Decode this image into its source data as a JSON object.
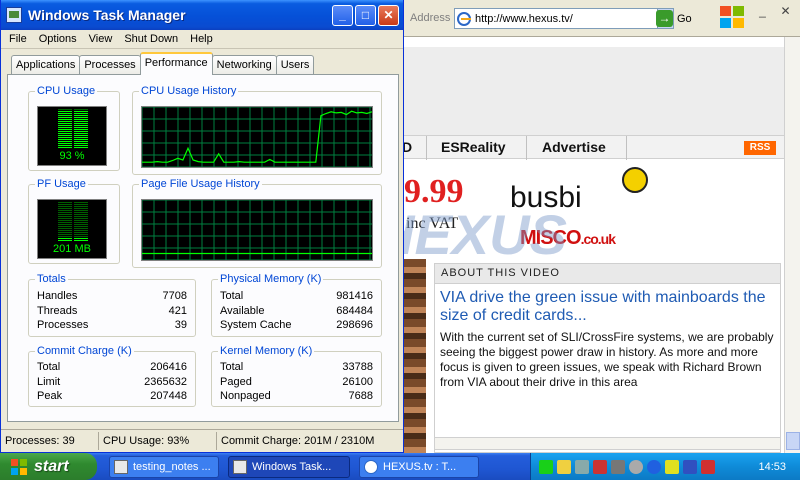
{
  "browser": {
    "address_label": "Address",
    "url": "http://www.hexus.tv/",
    "go_label": "Go",
    "nav": [
      "D",
      "ESReality",
      "Advertise"
    ],
    "rss": "RSS",
    "ad": {
      "price": "9.99",
      "vat": "inc VAT",
      "brand1": "busbi",
      "brand2": "MISCO",
      "brand2_suffix": ".co.uk"
    },
    "watermark": "HEXUS",
    "about": {
      "header": "ABOUT THIS VIDEO",
      "title": "VIA drive the green issue with mainboards the size of credit cards...",
      "body": "With the current set of SLI/CrossFire systems, we are probably seeing the biggest power draw in history. As more and more focus is given to green issues, we speak with Richard Brown from VIA about their drive in this area"
    }
  },
  "task_manager": {
    "title": "Windows Task Manager",
    "menu": [
      "File",
      "Options",
      "View",
      "Shut Down",
      "Help"
    ],
    "tabs": [
      "Applications",
      "Processes",
      "Performance",
      "Networking",
      "Users"
    ],
    "active_tab": "Performance",
    "cpu_usage": {
      "label": "CPU Usage",
      "value": "93 %",
      "percent": 93
    },
    "cpu_history": {
      "label": "CPU Usage History",
      "samples": [
        5,
        5,
        5,
        6,
        5,
        5,
        8,
        12,
        9,
        30,
        9,
        6,
        5,
        5,
        5,
        20,
        5,
        5,
        5,
        6,
        5,
        5,
        5,
        5,
        5,
        10,
        5,
        5,
        5,
        5,
        5,
        5,
        5,
        5,
        5,
        88,
        92,
        95,
        93,
        94,
        90,
        96,
        93,
        94,
        92,
        95
      ]
    },
    "pf_usage": {
      "label": "PF Usage",
      "value": "201 MB",
      "percent": 8
    },
    "pf_history": {
      "label": "Page File Usage History",
      "samples": [
        8,
        8,
        8,
        8,
        8,
        8,
        8,
        8,
        8,
        8,
        8,
        8,
        8,
        8,
        8,
        8,
        8,
        8,
        8,
        8,
        8,
        8,
        8,
        8,
        8,
        8,
        8,
        8,
        8,
        8,
        8,
        8,
        8,
        8,
        8,
        8,
        8,
        8,
        8,
        8,
        8,
        8,
        8,
        8,
        8,
        8
      ]
    },
    "totals": {
      "label": "Totals",
      "rows": [
        [
          "Handles",
          "7708"
        ],
        [
          "Threads",
          "421"
        ],
        [
          "Processes",
          "39"
        ]
      ]
    },
    "physical": {
      "label": "Physical Memory (K)",
      "rows": [
        [
          "Total",
          "981416"
        ],
        [
          "Available",
          "684484"
        ],
        [
          "System Cache",
          "298696"
        ]
      ]
    },
    "commit": {
      "label": "Commit Charge (K)",
      "rows": [
        [
          "Total",
          "206416"
        ],
        [
          "Limit",
          "2365632"
        ],
        [
          "Peak",
          "207448"
        ]
      ]
    },
    "kernel": {
      "label": "Kernel Memory (K)",
      "rows": [
        [
          "Total",
          "33788"
        ],
        [
          "Paged",
          "26100"
        ],
        [
          "Nonpaged",
          "7688"
        ]
      ]
    },
    "status": [
      "Processes: 39",
      "CPU Usage: 93%",
      "Commit Charge: 201M / 2310M"
    ]
  },
  "taskbar": {
    "start": "start",
    "tasks": [
      "testing_notes ...",
      "Windows Task...",
      "HEXUS.tv : T..."
    ],
    "active_task": 1,
    "clock": "14:53"
  },
  "colors": {
    "graph_green": "#00ff00",
    "grid": "#008040",
    "xp_blue": "#0a5ce0"
  }
}
